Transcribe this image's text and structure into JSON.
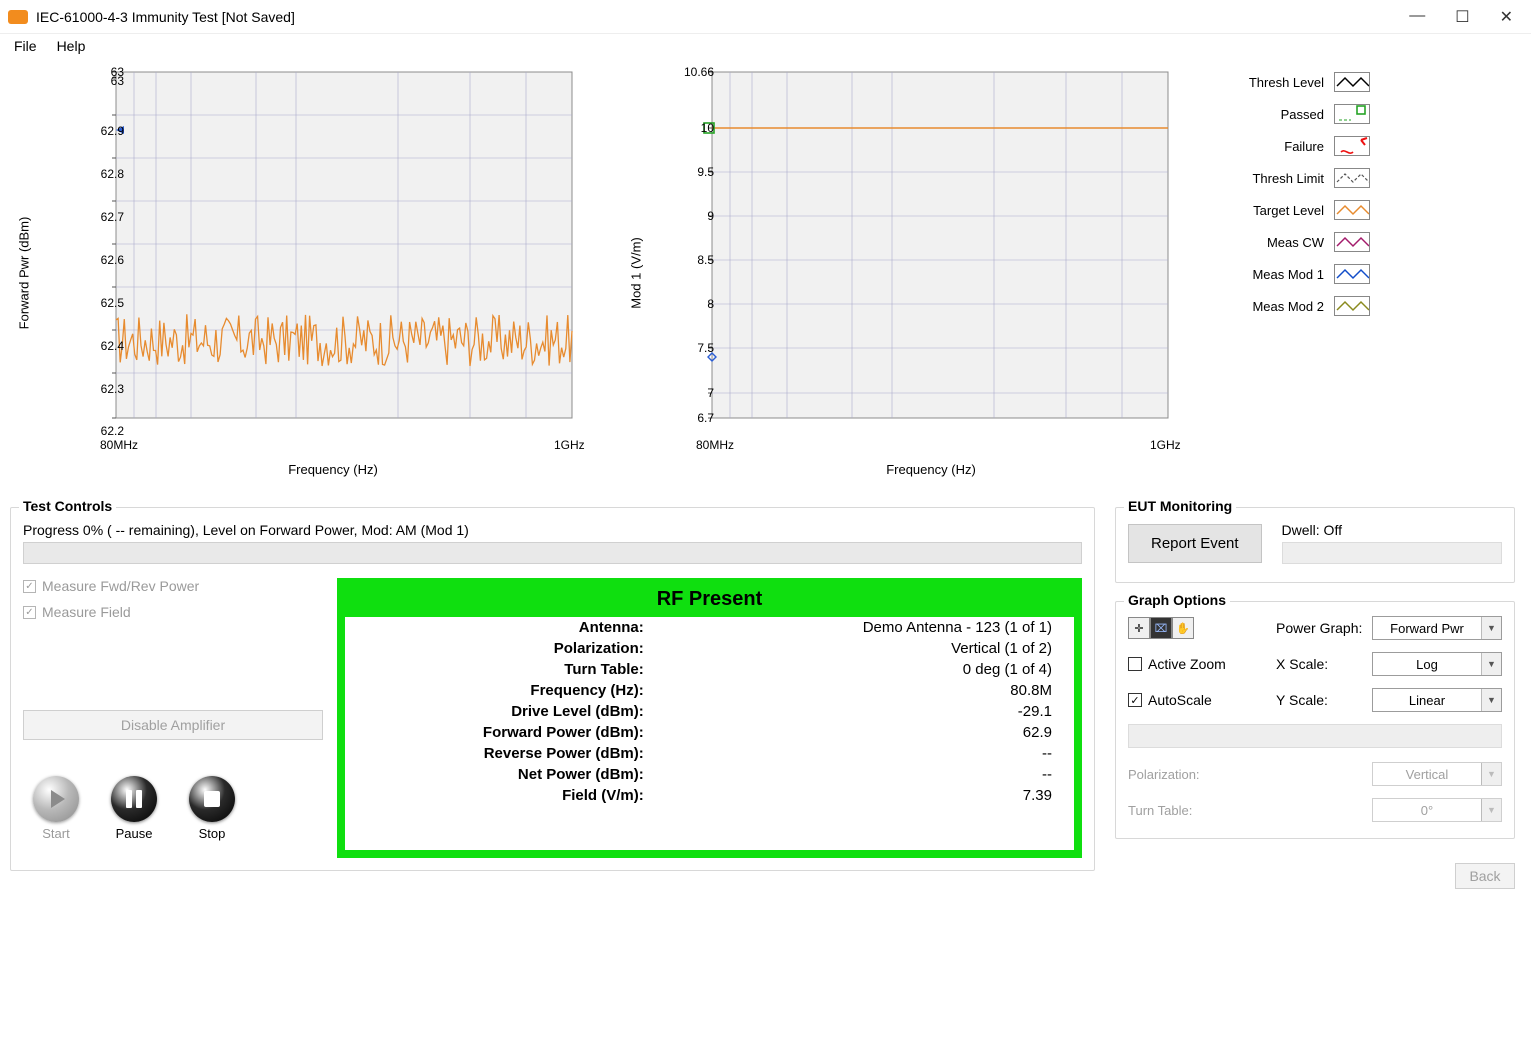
{
  "window": {
    "title": "IEC-61000-4-3 Immunity Test [Not Saved]"
  },
  "menu": {
    "file": "File",
    "help": "Help"
  },
  "chart_data": [
    {
      "type": "line",
      "title": "",
      "xlabel": "Frequency (Hz)",
      "ylabel": "Forward Pwr (dBm)",
      "x_range_labels": [
        "80MHz",
        "1GHz"
      ],
      "ylim": [
        62.2,
        63.0
      ],
      "y_ticks": [
        62.2,
        62.3,
        62.4,
        62.5,
        62.6,
        62.7,
        62.8,
        62.9,
        63.0,
        63.0
      ],
      "y_tick_labels": [
        "62.2",
        "62.3",
        "62.4",
        "62.5",
        "62.6",
        "62.7",
        "62.8",
        "62.9",
        "63",
        "63"
      ],
      "series": [
        {
          "name": "Meas",
          "color": "#e78b2f",
          "baseline": 62.38,
          "noise": 0.06
        }
      ],
      "marker": {
        "x": 80,
        "y": 62.9,
        "color": "#2a5dd4"
      }
    },
    {
      "type": "line",
      "title": "",
      "xlabel": "Frequency (Hz)",
      "ylabel": "Mod 1 (V/m)",
      "x_range_labels": [
        "80MHz",
        "1GHz"
      ],
      "ylim": [
        6.7,
        10.66
      ],
      "y_ticks": [
        6.7,
        7,
        7.5,
        8,
        8.5,
        9,
        9.5,
        10,
        10.66
      ],
      "y_tick_labels": [
        "6.7",
        "7",
        "7.5",
        "8",
        "8.5",
        "9",
        "9.5",
        "10",
        "10.66"
      ],
      "series": [
        {
          "name": "Target Level",
          "color": "#e78b2f",
          "constant": 10
        }
      ],
      "markers": [
        {
          "x": 80,
          "y": 10,
          "shape": "square",
          "color": "#26a326"
        },
        {
          "x": 80,
          "y": 7.39,
          "shape": "diamond",
          "color": "#2a5dd4"
        }
      ]
    }
  ],
  "legend": {
    "items": [
      {
        "label": "Thresh Level",
        "kind": "line-black"
      },
      {
        "label": "Passed",
        "kind": "pass-marker"
      },
      {
        "label": "Failure",
        "kind": "fail-marker"
      },
      {
        "label": "Thresh Limit",
        "kind": "thresh-limit"
      },
      {
        "label": "Target Level",
        "kind": "line-orange"
      },
      {
        "label": "Meas CW",
        "kind": "line-magenta"
      },
      {
        "label": "Meas Mod 1",
        "kind": "line-blue"
      },
      {
        "label": "Meas Mod 2",
        "kind": "line-olive"
      }
    ]
  },
  "test_controls": {
    "title": "Test Controls",
    "progress_text": "Progress 0% ( --  remaining), Level on Forward Power, Mod: AM (Mod 1)",
    "measure_fwd": "Measure Fwd/Rev Power",
    "measure_field": "Measure Field",
    "disable_amp": "Disable Amplifier",
    "start": "Start",
    "pause": "Pause",
    "stop": "Stop"
  },
  "rf": {
    "banner": "RF Present",
    "rows": [
      {
        "label": "Antenna:",
        "value": "Demo Antenna - 123 (1 of 1)"
      },
      {
        "label": "Polarization:",
        "value": "Vertical (1 of 2)"
      },
      {
        "label": "Turn Table:",
        "value": "0 deg (1 of 4)"
      },
      {
        "label": "Frequency (Hz):",
        "value": "80.8M"
      },
      {
        "label": "Drive Level (dBm):",
        "value": "-29.1"
      },
      {
        "label": "Forward Power (dBm):",
        "value": "62.9"
      },
      {
        "label": "Reverse Power (dBm):",
        "value": "--"
      },
      {
        "label": "Net Power (dBm):",
        "value": "--"
      },
      {
        "label": "Field (V/m):",
        "value": "7.39"
      }
    ]
  },
  "eut": {
    "title": "EUT Monitoring",
    "report_btn": "Report Event",
    "dwell_label": "Dwell: Off"
  },
  "graph_opts": {
    "title": "Graph Options",
    "active_zoom": "Active Zoom",
    "autoscale": "AutoScale",
    "power_graph_label": "Power Graph:",
    "power_graph_value": "Forward Pwr",
    "xscale_label": "X Scale:",
    "xscale_value": "Log",
    "yscale_label": "Y Scale:",
    "yscale_value": "Linear",
    "polarization_label": "Polarization:",
    "polarization_value": "Vertical",
    "turntable_label": "Turn Table:",
    "turntable_value": "0°"
  },
  "back_btn": "Back"
}
